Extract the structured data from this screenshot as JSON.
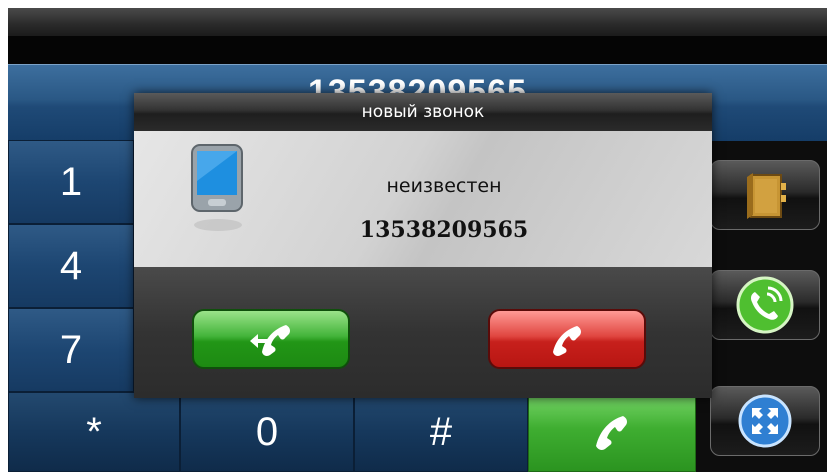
{
  "display": {
    "number": "13538209565"
  },
  "keypad": {
    "rows": [
      [
        "1"
      ],
      [
        "4"
      ],
      [
        "7"
      ]
    ],
    "bottom_row": [
      "*",
      "0",
      "#"
    ]
  },
  "dialog": {
    "title": "новый звонок",
    "caller_name": "неизвестен",
    "caller_number": "13538209565",
    "answer_icon": "answer-phone-icon",
    "reject_icon": "hangup-phone-icon"
  },
  "side_buttons": [
    {
      "icon": "contacts-book-icon"
    },
    {
      "icon": "call-log-icon"
    },
    {
      "icon": "fullscreen-icon"
    }
  ],
  "colors": {
    "answer": "#3fae31",
    "reject": "#d2302b",
    "panel_blue": "#1f4a77"
  }
}
